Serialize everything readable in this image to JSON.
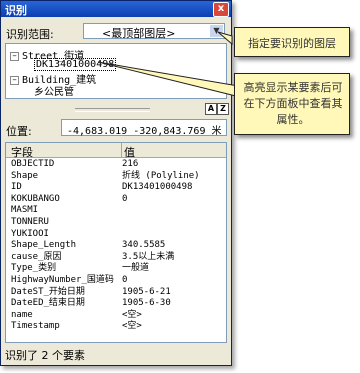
{
  "window": {
    "title": "识别"
  },
  "scope": {
    "label": "识别范围:",
    "value": "<最顶部图层>"
  },
  "tree": {
    "nodes": [
      {
        "label": "Street_街道",
        "expanded": true
      },
      {
        "label": "DK13401000498",
        "selected": true
      },
      {
        "label": "Building_建筑",
        "expanded": true
      },
      {
        "label": "乡公民管"
      }
    ]
  },
  "position": {
    "label": "位置:",
    "value": "-4,683.019  -320,843.769 米"
  },
  "grid": {
    "headers": {
      "field": "字段",
      "value": "值"
    },
    "rows": [
      {
        "field": "OBJECTID",
        "value": "216"
      },
      {
        "field": "Shape",
        "value": "折线 (Polyline)"
      },
      {
        "field": "ID",
        "value": "DK13401000498"
      },
      {
        "field": "KOKUBANGO",
        "value": "0"
      },
      {
        "field": "MASMI",
        "value": ""
      },
      {
        "field": "TONNERU",
        "value": ""
      },
      {
        "field": "YUKIOOI",
        "value": ""
      },
      {
        "field": "Shape_Length",
        "value": "340.5585"
      },
      {
        "field": "cause_原因",
        "value": "3.5以上未满"
      },
      {
        "field": "Type_类别",
        "value": "一般道"
      },
      {
        "field": "HighwayNumber_国道码",
        "value": "0"
      },
      {
        "field": "DateST_开始日期",
        "value": "1905-6-21"
      },
      {
        "field": "DateED_结束日期",
        "value": "1905-6-30"
      },
      {
        "field": "name",
        "value": "<空>"
      },
      {
        "field": "Timestamp",
        "value": "<空>"
      }
    ]
  },
  "status": "识别了 2 个要素",
  "callouts": {
    "scope_hint": "指定要识别的图层",
    "feature_hint_lines": [
      "高亮显示某要素后可",
      "在下方面板中查看其",
      "属性。"
    ]
  },
  "toolbar": {
    "close": "x",
    "btn_a": "A",
    "btn_z": "Z"
  },
  "icons": {
    "close": "close-icon",
    "dropdown": "chevron-down-icon",
    "expand": "tree-collapse-icon"
  },
  "colors": {
    "titlebar": "#0a3fb0",
    "callout": "#fff8b8",
    "panel": "#ece9d8"
  }
}
